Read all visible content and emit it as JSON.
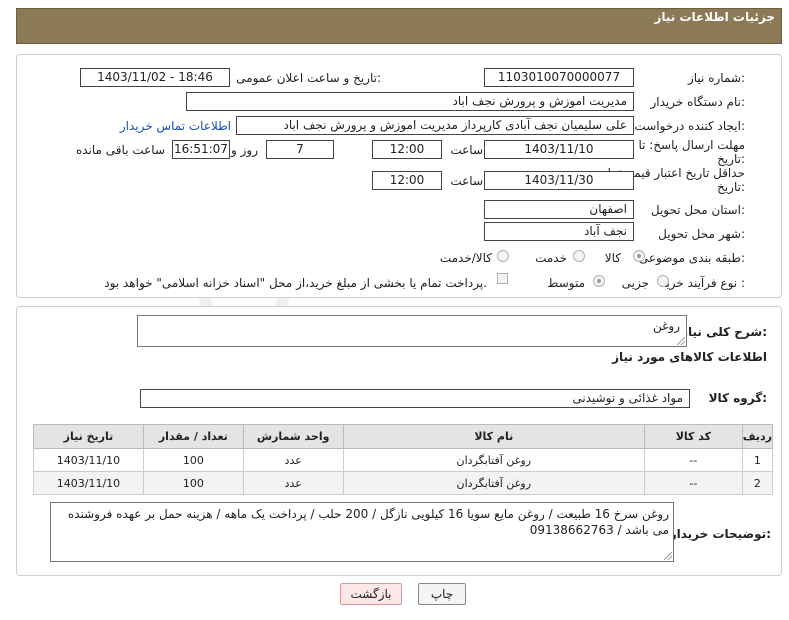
{
  "header": {
    "title": "جزئیات اطلاعات نیاز"
  },
  "fields": {
    "need_number_label": "شماره نیاز:",
    "need_number": "1103010070000077",
    "announce_label": "تاریخ و ساعت اعلان عمومی:",
    "announce_value": "1403/11/02 - 18:46",
    "buyer_org_label": "نام دستگاه خریدار:",
    "buyer_org": "مدیریت اموزش و پرورش نجف اباد",
    "creator_label": "ایجاد کننده درخواست:",
    "creator": "علی سلیمیان نجف آبادی کارپرداز مدیریت اموزش و پرورش نجف اباد",
    "contact_link": "اطلاعات تماس خریدار",
    "deadline_label_1": "مهلت ارسال پاسخ: تا",
    "deadline_label_2": "تاریخ:",
    "deadline_date": "1403/11/10",
    "time_label": "ساعت",
    "deadline_time": "12:00",
    "days_value": "7",
    "days_label": "روز و",
    "remaining_time": "16:51:07",
    "remaining_label": "ساعت باقی مانده",
    "validity_label_1": "حداقل تاریخ اعتبار قیمت: تا",
    "validity_label_2": "تاریخ:",
    "validity_date": "1403/11/30",
    "validity_time": "12:00",
    "province_label": "استان محل تحویل:",
    "province": "اصفهان",
    "city_label": "شهر محل تحویل:",
    "city": "نجف آباد",
    "category_label": "طبقه بندی موضوعی:",
    "category_options": [
      "کالا",
      "خدمت",
      "کالا/خدمت"
    ],
    "process_label": "نوع فرآیند خرید :",
    "process_options": [
      "جزیی",
      "متوسط"
    ],
    "payment_note": "پرداخت تمام یا بخشی از مبلغ خرید،از محل \"اسناد خزانه اسلامی\" خواهد بود."
  },
  "summary": {
    "label": "شرح کلی نیاز:",
    "value": "روغن",
    "goods_info_title": "اطلاعات کالاهای مورد نیاز",
    "group_label": "گروه کالا:",
    "group_value": "مواد غذائی و نوشیدنی"
  },
  "table": {
    "headers": [
      "ردیف",
      "کد کالا",
      "نام کالا",
      "واحد شمارش",
      "تعداد / مقدار",
      "تاریخ نیاز"
    ],
    "rows": [
      [
        "1",
        "--",
        "روغن آفتابگردان",
        "عدد",
        "100",
        "1403/11/10"
      ],
      [
        "2",
        "--",
        "روغن آفتابگردان",
        "عدد",
        "100",
        "1403/11/10"
      ]
    ]
  },
  "notes": {
    "label": "توضیحات خریدار:",
    "value": "روغن سرخ 16 طبیعت / روغن مایع سویا 16 کیلویی نازگل / 200 حلب / پرداخت یک ماهه / هزینه حمل بر عهده فروشنده می باشد / 09138662763"
  },
  "buttons": {
    "print": "چاپ",
    "back": "بازگشت"
  },
  "colors": {
    "header": "#8c7a56",
    "link": "#1a4fb5",
    "back_button": "#fde6e6"
  }
}
